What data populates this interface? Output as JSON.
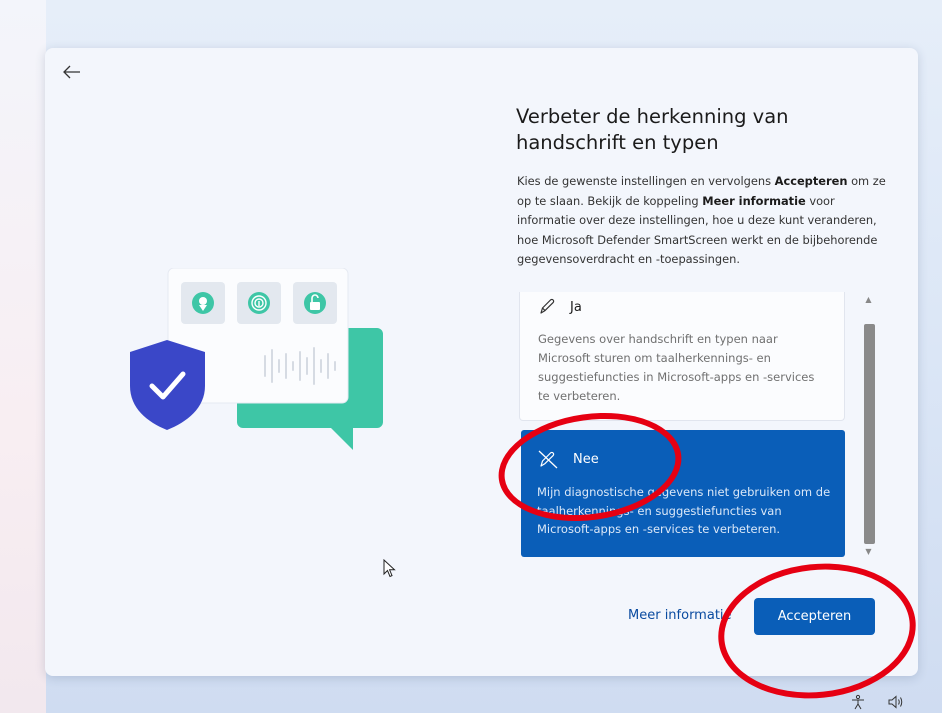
{
  "dialog": {
    "title": "Verbeter de herkenning van handschrift en typen",
    "description": {
      "p1": "Kies de gewenste instellingen en vervolgens ",
      "b1": "Accepteren",
      "p2": " om ze op te slaan. Bekijk de koppeling ",
      "b2": "Meer informatie",
      "p3": " voor informatie over deze instellingen, hoe u deze kunt veranderen, hoe Microsoft Defender SmartScreen werkt en de bijbehorende gegevensoverdracht en -toepassingen."
    },
    "options": [
      {
        "label": "Ja",
        "icon": "pen-icon",
        "text": "Gegevens over handschrift en typen naar Microsoft sturen om taalherkennings- en suggestiefuncties in Microsoft-apps en -services te verbeteren."
      },
      {
        "label": "Nee",
        "icon": "pen-off-icon",
        "text": "Mijn diagnostische gegevens niet gebruiken om de taalherkennings- en suggestiefuncties van Microsoft-apps en -services te verbeteren."
      }
    ],
    "selected": "Nee",
    "more_info_link": "Meer informatie",
    "accept_button": "Accepteren"
  },
  "colors": {
    "accent": "#0a5eb8",
    "annotation": "#e60012",
    "shield": "#3a47c8",
    "bubble": "#3ec6a6"
  },
  "tray": {
    "accessibility_icon": "accessibility-icon",
    "volume_icon": "volume-icon"
  }
}
